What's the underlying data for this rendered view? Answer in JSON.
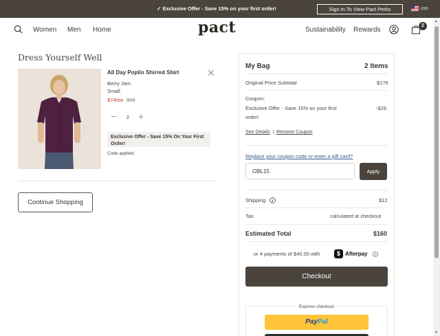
{
  "promo_bar": {
    "text": "✓ Exclusive Offer - Save 15% on your first order!",
    "perks_button": "Sign In To View Pact Perks",
    "currency": "USD"
  },
  "nav": {
    "left_links": [
      "Women",
      "Men",
      "Home"
    ],
    "logo": "pact",
    "right_links": [
      "Sustainability",
      "Rewards"
    ],
    "cart_count": "2"
  },
  "page_title": "Dress Yourself Well",
  "cart_item": {
    "name": "All Day Poplin Shirred Shirt",
    "color": "Berry Jam",
    "size": "Small",
    "sale_price": "$74/ea",
    "original_price": "$88",
    "quantity": "2",
    "promo_message": "Exclusive Offer - Save 15% On Your First Order!",
    "code_status": "Code applied."
  },
  "continue_shopping": "Continue Shopping",
  "summary": {
    "title": "My Bag",
    "item_count": "2 Items",
    "subtotal_label": "Original Price Subtotal",
    "subtotal_value": "$176",
    "coupon_label": "Coupon:",
    "coupon_desc_line1": "Exclusive Offer - Save 15% on your first",
    "coupon_desc_line2": "order!",
    "coupon_value": "-$28",
    "see_details": "See Details",
    "separator": "|",
    "remove_coupon": "Remove Coupon",
    "replace_link": "Replace your coupon code or enter a gift card?",
    "coupon_code_value": "OBL15",
    "apply_label": "Apply",
    "shipping_label": "Shipping",
    "shipping_value": "$12",
    "tax_label": "Tax",
    "tax_value": "calculated at checkout",
    "total_label": "Estimated Total",
    "total_value": "$160",
    "installments_text": "or 4 payments of $40.00 with",
    "afterpay_label": "Afterpay",
    "checkout_label": "Checkout",
    "express_label": "Express checkout",
    "paypal_pay": "Pay",
    "paypal_pal": "Pal"
  },
  "colors": {
    "brand_dark": "#4a443d",
    "sale_red": "#c0392b",
    "paypal_yellow": "#ffc439",
    "link_blue": "#3a5a8a"
  },
  "icons": [
    "search-icon",
    "user-icon",
    "bag-icon",
    "close-icon",
    "info-icon",
    "us-flag-icon"
  ]
}
